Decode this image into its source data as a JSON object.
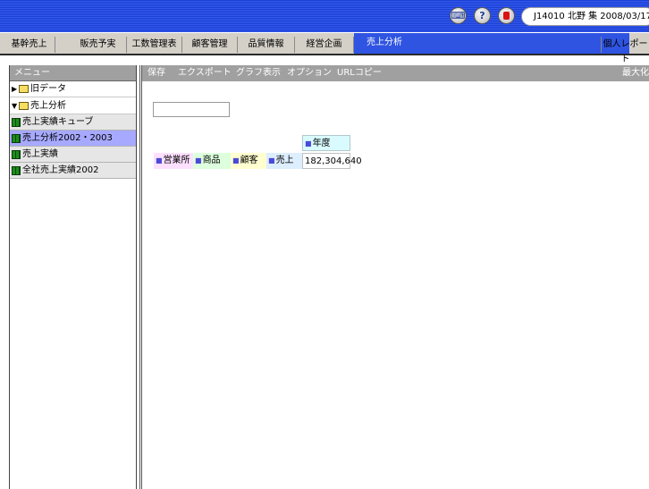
{
  "header": {
    "user_info": "J14010 北野 集  2008/03/17",
    "icons": [
      "ime-icon",
      "help-icon",
      "exit-icon"
    ]
  },
  "tabs": [
    {
      "label": "基幹売上",
      "active": false
    },
    {
      "label": "販売予実",
      "active": false
    },
    {
      "label": "工数管理表",
      "active": false
    },
    {
      "label": "顧客管理",
      "active": false
    },
    {
      "label": "品質情報",
      "active": false
    },
    {
      "label": "経営企画",
      "active": false
    },
    {
      "label": "売上分析",
      "active": true
    },
    {
      "label": "個人レポート",
      "active": false
    }
  ],
  "sidebar": {
    "title": "メニュー",
    "items": [
      {
        "label": "旧データ",
        "kind": "folder",
        "expanded": false
      },
      {
        "label": "売上分析",
        "kind": "folder",
        "expanded": true
      },
      {
        "label": "売上実績キューブ",
        "kind": "cube",
        "selected": false
      },
      {
        "label": "売上分析2002・2003",
        "kind": "cube",
        "selected": true
      },
      {
        "label": "売上実績",
        "kind": "cube",
        "selected": false
      },
      {
        "label": "全社売上実績2002",
        "kind": "cube",
        "selected": false
      }
    ]
  },
  "toolbar": {
    "save": "保存",
    "export": "エクスポート",
    "graph": "グラフ表示",
    "options": "オプション",
    "url_copy": "URLコピー",
    "maximize": "最大化"
  },
  "pivot": {
    "column_field": "年度",
    "row_fields": [
      "営業所",
      "商品",
      "顧客"
    ],
    "data_field": "売上",
    "total": "182,304,640"
  },
  "colors": {
    "header_blue": "#1a3fd6",
    "active_tab": "#2f54e2",
    "selected_item": "#a7a9ff",
    "col_field_bg": "#d9fbff",
    "row_field_bg": "#fde0ff",
    "row_field2_bg": "#ddffdd",
    "row_field3_bg": "#ffffd0",
    "data_field_bg": "#ddeeff"
  }
}
